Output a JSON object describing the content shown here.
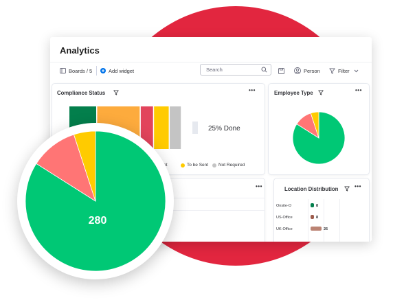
{
  "app": {
    "title": "Analytics"
  },
  "toolbar": {
    "boards_label": "Boards / 5",
    "add_widget_label": "Add widget",
    "search_placeholder": "Search",
    "person_label": "Person",
    "filter_label": "Filter"
  },
  "widgets": {
    "compliance": {
      "title": "Compliance Status",
      "done_label": "25% Done",
      "legend": [
        {
          "label": "pliant",
          "color": "#fdab3d"
        },
        {
          "label": "To be Sent",
          "color": "#ffcb00"
        },
        {
          "label": "Not Required",
          "color": "#c4c4c4"
        }
      ],
      "segments": [
        {
          "color": "#037f4c",
          "fraction": 0.23
        },
        {
          "color": "#fdab3d",
          "fraction": 0.36
        },
        {
          "color": "#e2445c",
          "fraction": 0.11
        },
        {
          "color": "#ffcb00",
          "fraction": 0.13
        },
        {
          "color": "#c4c4c4",
          "fraction": 0.1
        }
      ]
    },
    "employee_type": {
      "title": "Employee Type",
      "slices": [
        {
          "value": 0.84,
          "color": "#00c875"
        },
        {
          "value": 0.11,
          "color": "#ff7575"
        },
        {
          "value": 0.05,
          "color": "#ffcb00"
        }
      ]
    },
    "location": {
      "title": "Location Distribution",
      "rows": [
        {
          "label": "Onsite-O",
          "value": "8",
          "color": "#037f4c"
        },
        {
          "label": "US-Office",
          "value": "8",
          "color": "#9d5c4c"
        },
        {
          "label": "UK-Office",
          "value": "26",
          "color": "#bb8373"
        }
      ]
    }
  },
  "big_pie": {
    "label": "280",
    "slices": [
      {
        "value": 0.84,
        "color": "#00c875"
      },
      {
        "value": 0.11,
        "color": "#ff7575"
      },
      {
        "value": 0.05,
        "color": "#ffcb00"
      }
    ]
  }
}
